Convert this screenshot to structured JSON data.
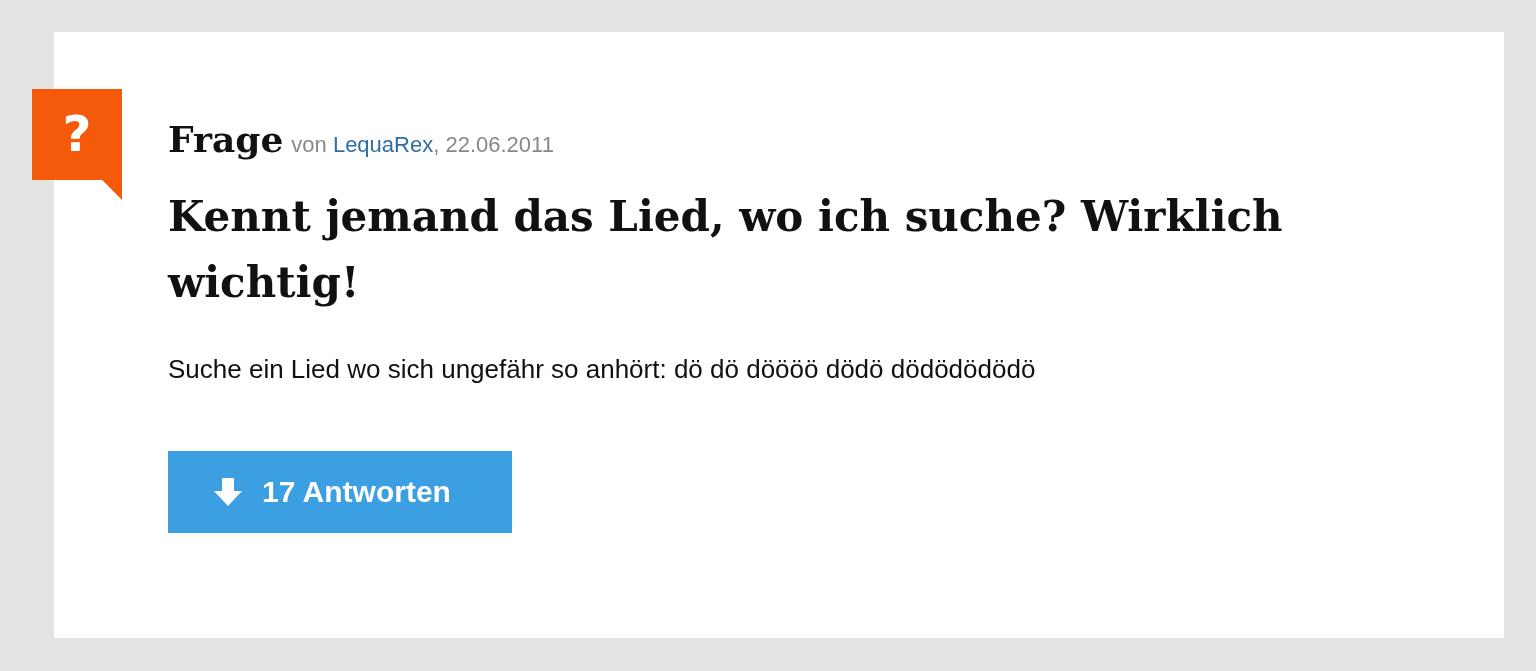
{
  "question": {
    "badge": "?",
    "label": "Frage",
    "meta_prefix": "von",
    "author": "LequaRex",
    "meta_suffix": ", 22.06.2011",
    "title": "Kennt jemand das Lied, wo ich suche? Wirklich wichtig!",
    "body": "Suche ein Lied wo sich ungefähr so anhört: dö dö döööö dödö dödödödödö",
    "answers_button": {
      "label": "17 Antworten"
    }
  }
}
